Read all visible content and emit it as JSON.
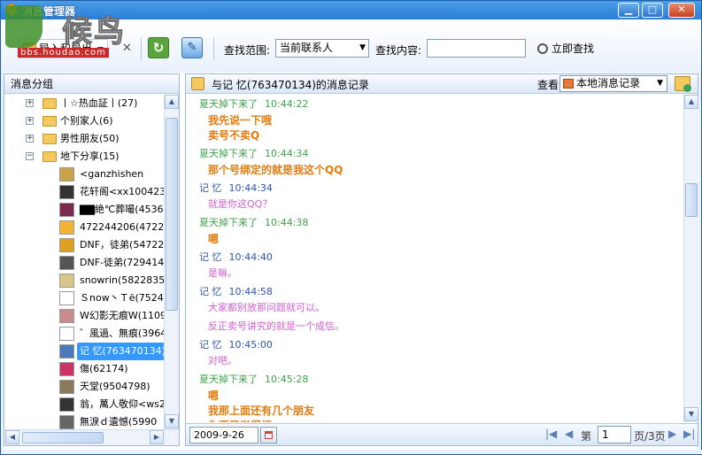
{
  "window": {
    "title": "消息管理器",
    "watermark_logo": "候鸟",
    "watermark_url": "bbs.houdao.com"
  },
  "toolbar": {
    "import_export_label": "导入和导出",
    "search_scope_label": "查找范围:",
    "search_scope_value": "当前联系人",
    "search_content_label": "查找内容:",
    "search_content_value": "",
    "search_now_label": "立即查找"
  },
  "left": {
    "header": "消息分组",
    "groups": [
      {
        "label": "丨☆热血証丨(27)"
      },
      {
        "label": "个别家人(6)"
      },
      {
        "label": "男性朋友(50)"
      },
      {
        "label": "地下分享(15)"
      }
    ],
    "contacts": [
      {
        "label": "<ganzhishen",
        "avatar": "#c9a24a"
      },
      {
        "label": "花轩阁<xx100423",
        "avatar": "#333333"
      },
      {
        "label": "▇▇絶℃葬嘬(4536",
        "avatar": "#7a2b4a"
      },
      {
        "label": "472244206(4722442",
        "avatar": "#f2b632"
      },
      {
        "label": "DNF，徒弟(5472283",
        "avatar": "#e0a020"
      },
      {
        "label": "DNF-徒弟(72941456",
        "avatar": "#555555"
      },
      {
        "label": "snowrin(582283520)",
        "avatar": "#d9c78a"
      },
      {
        "label": "Ｓnow丶Ｔё(752469",
        "avatar": "#ffffff"
      },
      {
        "label": "W幻影无痕W(11098",
        "avatar": "#c98c8c"
      },
      {
        "label": "゛風過、無痕(3964",
        "avatar": "#ffffff"
      },
      {
        "label": "记 忆(763470134)",
        "avatar": "#4a78b8"
      },
      {
        "label": "傷(62174)",
        "avatar": "#cc3366"
      },
      {
        "label": "天堂(9504798)",
        "avatar": "#8a7a5a"
      },
      {
        "label": "翁，萬人敬仰<ws2",
        "avatar": "#333333"
      },
      {
        "label": "無淚ｄ遺憾(5990",
        "avatar": "#666666"
      }
    ],
    "selected_contact": "记 忆(763470134)"
  },
  "right": {
    "header_title": "与记 忆(763470134)的消息记录",
    "view_label": "查看",
    "view_value": "本地消息记录",
    "messages": [
      {
        "who": "夏天掉下来了",
        "time": "10:44:22",
        "lines": [
          "我先说一下哦",
          "卖号不卖Q"
        ],
        "style": "orange"
      },
      {
        "who": "夏天掉下来了",
        "time": "10:44:34",
        "lines": [
          "那个号绑定的就是我这个QQ"
        ],
        "style": "orange"
      },
      {
        "who": "记 忆",
        "time": "10:44:34",
        "lines": [
          "就是你这QQ？"
        ],
        "style": "pink"
      },
      {
        "who": "夏天掉下来了",
        "time": "10:44:38",
        "lines": [
          "嗯"
        ],
        "style": "orange"
      },
      {
        "who": "记 忆",
        "time": "10:44:40",
        "lines": [
          "是嘛。"
        ],
        "style": "pink"
      },
      {
        "who": "记 忆",
        "time": "10:44:58",
        "lines": [
          "大家都别放那问题就可以。",
          "反正卖号讲究的就是一个成信。"
        ],
        "style": "pink"
      },
      {
        "who": "记 忆",
        "time": "10:45:00",
        "lines": [
          "对吧。"
        ],
        "style": "pink"
      },
      {
        "who": "夏天掉下来了",
        "time": "10:45:28",
        "lines": [
          "嗯",
          "我那上面还有几个朋友",
          "你要是觉得烦"
        ],
        "style": "orange"
      }
    ],
    "footer": {
      "date": "2009-9-26",
      "page_prefix": "第",
      "page_value": "1",
      "page_suffix": "页/3页"
    }
  }
}
